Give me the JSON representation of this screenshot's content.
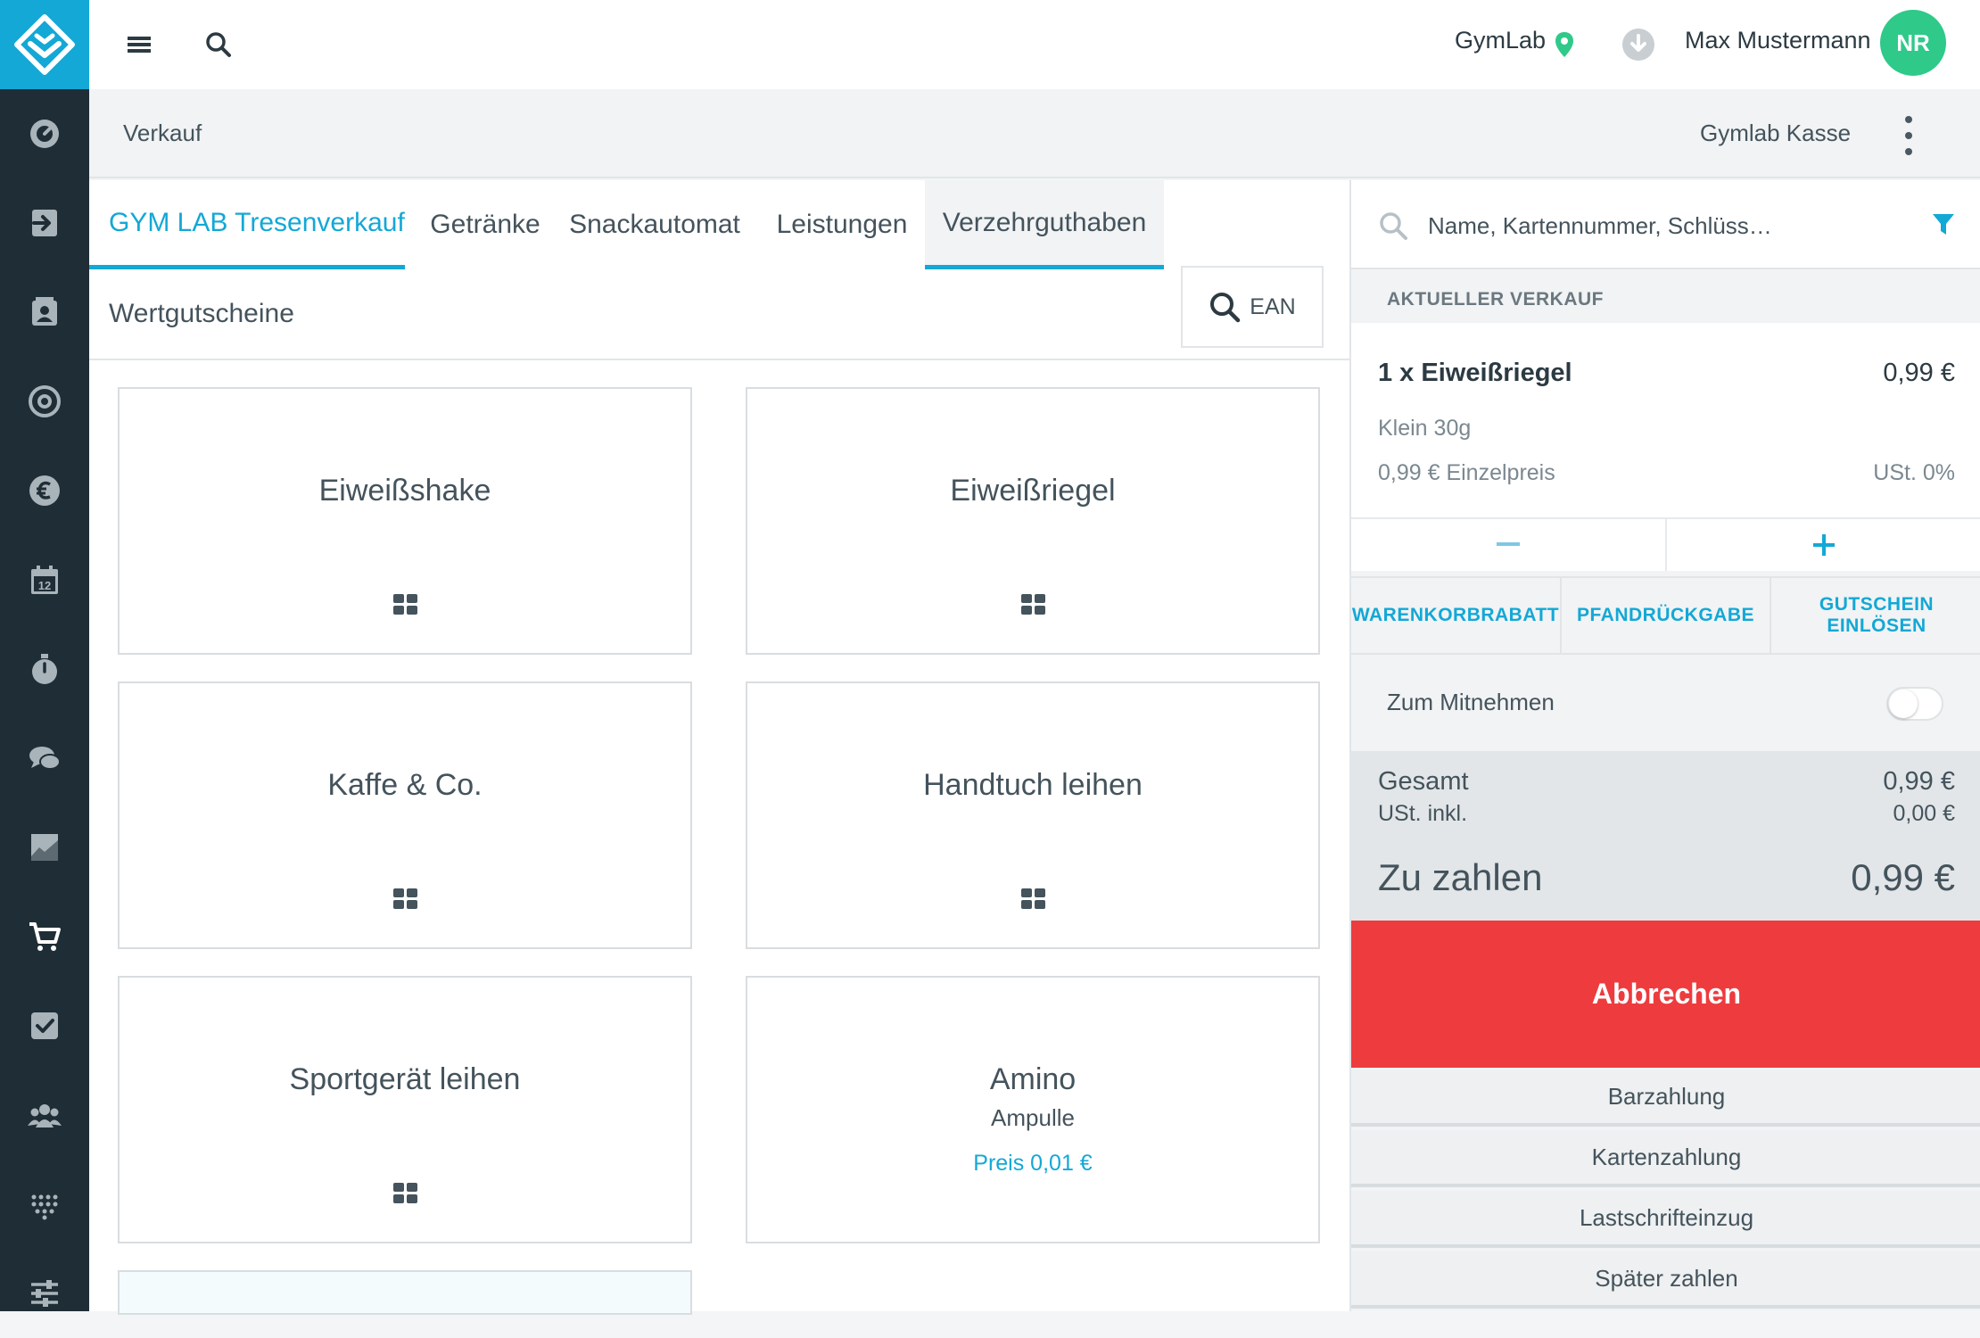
{
  "topbar": {
    "location": "GymLab",
    "user_name": "Max Mustermann",
    "avatar_initials": "NR"
  },
  "subheader": {
    "title": "Verkauf",
    "register": "Gymlab Kasse"
  },
  "tabs": [
    {
      "label": "GYM LAB Tresenverkauf"
    },
    {
      "label": "Getränke"
    },
    {
      "label": "Snackautomat"
    },
    {
      "label": "Leistungen"
    },
    {
      "label": "Verzehrguthaben"
    },
    {
      "label": "Wertgutscheine"
    }
  ],
  "ean_label": "EAN",
  "products": [
    {
      "name": "Eiweißshake"
    },
    {
      "name": "Eiweißriegel"
    },
    {
      "name": "Kaffe & Co."
    },
    {
      "name": "Handtuch leihen"
    },
    {
      "name": "Sportgerät leihen"
    },
    {
      "name": "Amino",
      "subtitle": "Ampulle",
      "price": "Preis 0,01 €"
    }
  ],
  "cart": {
    "search_placeholder": "Name, Kartennummer, Schlüss…",
    "section_title": "AKTUELLER VERKAUF",
    "item": {
      "title": "1 x Eiweißriegel",
      "price": "0,99 €",
      "variant": "Klein 30g",
      "unit_price": "0,99 € Einzelpreis",
      "tax": "USt. 0%"
    },
    "actions": [
      "WARENKORBRABATT",
      "PFANDRÜCKGABE",
      "GUTSCHEIN EINLÖSEN"
    ],
    "takeaway_label": "Zum Mitnehmen",
    "takeaway_on": false,
    "totals": {
      "total_label": "Gesamt",
      "total_value": "0,99 €",
      "tax_label": "USt. inkl.",
      "tax_value": "0,00 €",
      "due_label": "Zu zahlen",
      "due_value": "0,99 €"
    },
    "cancel_label": "Abbrechen",
    "payment_methods": [
      "Barzahlung",
      "Kartenzahlung",
      "Lastschrifteinzug",
      "Später zahlen"
    ]
  },
  "colors": {
    "accent": "#13a8d6",
    "sidebar": "#1f2d36",
    "danger": "#ee3b3e",
    "avatar": "#2fc98a",
    "location_pin": "#2fc98a"
  }
}
